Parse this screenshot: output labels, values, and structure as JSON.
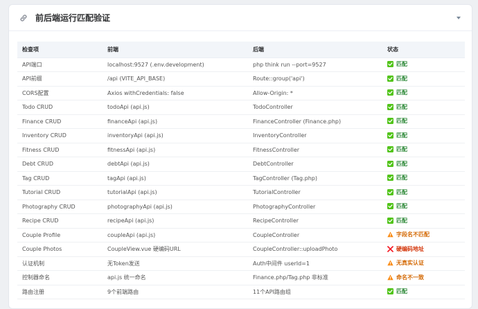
{
  "header": {
    "title": "前后端运行匹配验证"
  },
  "table": {
    "columns": [
      "检查项",
      "前端",
      "后端",
      "状态"
    ],
    "rows": [
      {
        "item": "API端口",
        "frontend": "localhost:9527 (.env.development)",
        "backend": "php think run --port=9527",
        "status": "匹配",
        "level": "ok"
      },
      {
        "item": "API前缀",
        "frontend": "/api (VITE_API_BASE)",
        "backend": "Route::group('api')",
        "status": "匹配",
        "level": "ok"
      },
      {
        "item": "CORS配置",
        "frontend": "Axios withCredentials: false",
        "backend": "Allow-Origin: *",
        "status": "匹配",
        "level": "ok"
      },
      {
        "item": "Todo CRUD",
        "frontend": "todoApi (api.js)",
        "backend": "TodoController",
        "status": "匹配",
        "level": "ok"
      },
      {
        "item": "Finance CRUD",
        "frontend": "financeApi (api.js)",
        "backend": "FinanceController (Finance.php)",
        "status": "匹配",
        "level": "ok"
      },
      {
        "item": "Inventory CRUD",
        "frontend": "inventoryApi (api.js)",
        "backend": "InventoryController",
        "status": "匹配",
        "level": "ok"
      },
      {
        "item": "Fitness CRUD",
        "frontend": "fitnessApi (api.js)",
        "backend": "FitnessController",
        "status": "匹配",
        "level": "ok"
      },
      {
        "item": "Debt CRUD",
        "frontend": "debtApi (api.js)",
        "backend": "DebtController",
        "status": "匹配",
        "level": "ok"
      },
      {
        "item": "Tag CRUD",
        "frontend": "tagApi (api.js)",
        "backend": "TagController (Tag.php)",
        "status": "匹配",
        "level": "ok"
      },
      {
        "item": "Tutorial CRUD",
        "frontend": "tutorialApi (api.js)",
        "backend": "TutorialController",
        "status": "匹配",
        "level": "ok"
      },
      {
        "item": "Photography CRUD",
        "frontend": "photographyApi (api.js)",
        "backend": "PhotographyController",
        "status": "匹配",
        "level": "ok"
      },
      {
        "item": "Recipe CRUD",
        "frontend": "recipeApi (api.js)",
        "backend": "RecipeController",
        "status": "匹配",
        "level": "ok"
      },
      {
        "item": "Couple Profile",
        "frontend": "coupleApi (api.js)",
        "backend": "CoupleController",
        "status": "字段名不匹配",
        "level": "warn"
      },
      {
        "item": "Couple Photos",
        "frontend": "CoupleView.vue 硬编码URL",
        "backend": "CoupleController::uploadPhoto",
        "status": "硬编码地址",
        "level": "err"
      },
      {
        "item": "认证机制",
        "frontend": "无Token发送",
        "backend": "Auth中间件 userId=1",
        "status": "无真实认证",
        "level": "warn"
      },
      {
        "item": "控制器命名",
        "frontend": "api.js 统一命名",
        "backend": "Finance.php/Tag.php 非标准",
        "status": "命名不一致",
        "level": "warn"
      },
      {
        "item": "路由注册",
        "frontend": "9个前端路由",
        "backend": "11个API路由组",
        "status": "匹配",
        "level": "ok"
      }
    ]
  },
  "colors": {
    "ok": "#2f8a3a",
    "warn": "#d46b08",
    "err": "#d4380d",
    "ok_badge": "#52c41a"
  },
  "icons": {
    "title": "link-icon",
    "collapse": "caret-down-icon",
    "ok": "check-square-icon",
    "warn": "warning-triangle-icon",
    "err": "cross-icon"
  }
}
